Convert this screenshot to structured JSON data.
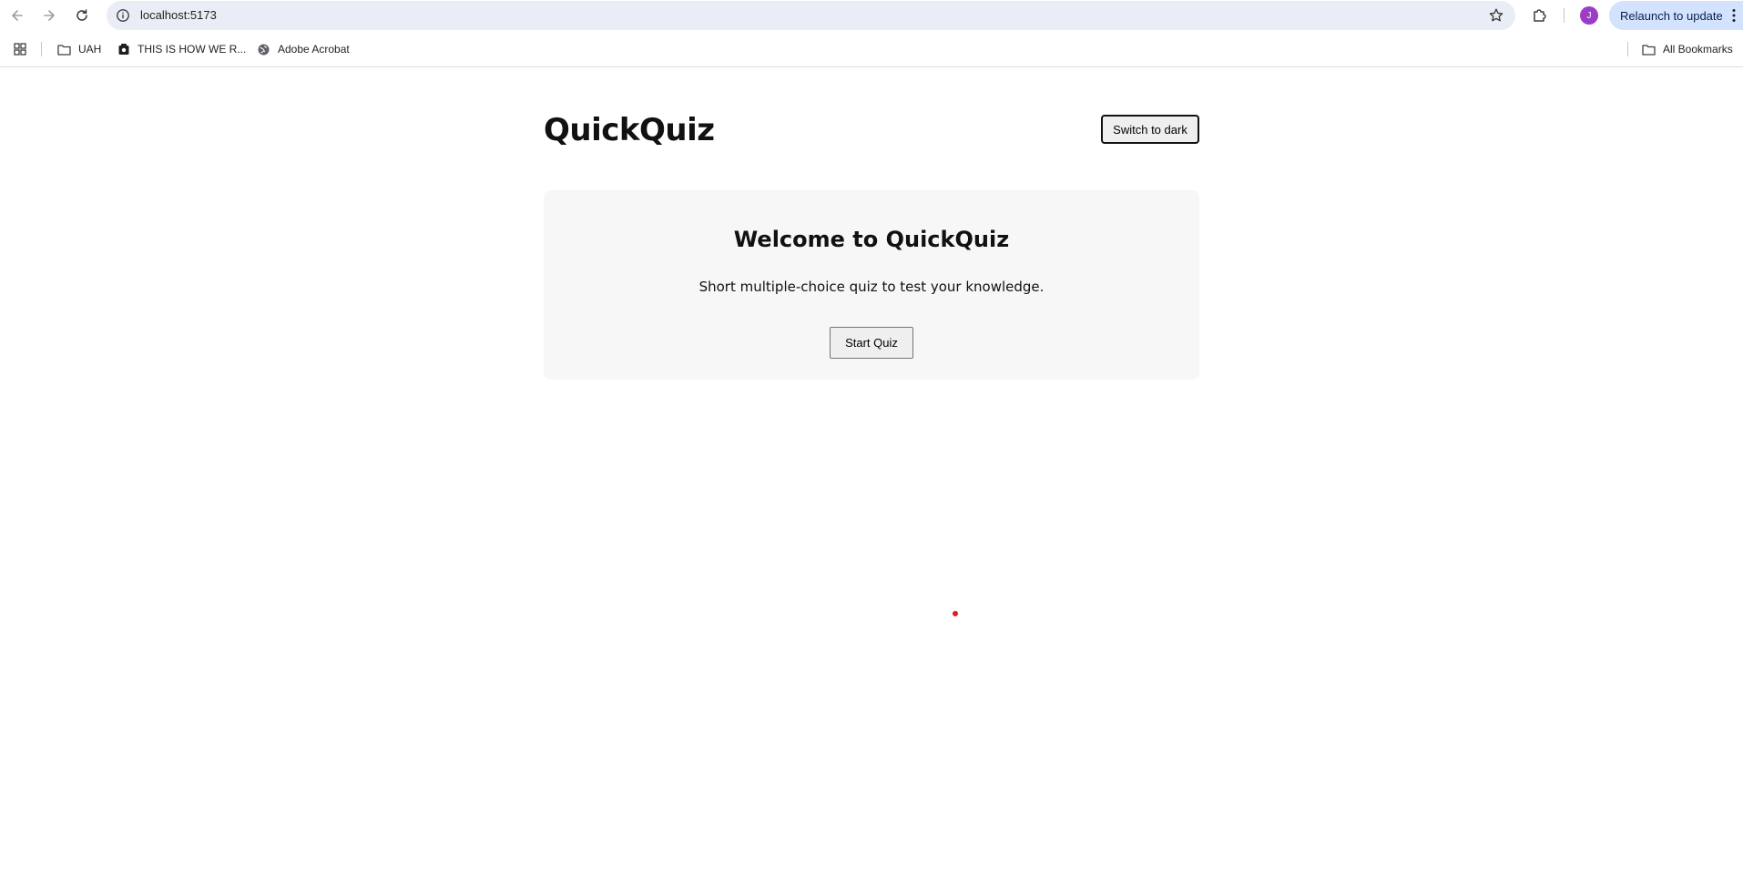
{
  "browser": {
    "url": "localhost:5173",
    "profile_initial": "J",
    "relaunch_label": "Relaunch to update",
    "icons": {
      "back": "arrow-left-icon",
      "forward": "arrow-right-icon",
      "reload": "reload-icon",
      "site_info": "info-icon",
      "bookmark_star": "star-icon",
      "extensions": "puzzle-icon",
      "menu": "kebab-icon"
    }
  },
  "bookmarks": {
    "items": [
      {
        "label": "UAH",
        "icon": "folder-icon"
      },
      {
        "label": "THIS IS HOW WE R...",
        "icon": "bookmark-favicon-icon"
      },
      {
        "label": "Adobe Acrobat",
        "icon": "globe-icon"
      }
    ],
    "all_bookmarks_label": "All Bookmarks"
  },
  "app": {
    "title": "QuickQuiz",
    "theme_toggle_label": "Switch to dark",
    "welcome": {
      "heading": "Welcome to QuickQuiz",
      "description": "Short multiple-choice quiz to test your knowledge.",
      "start_label": "Start Quiz"
    }
  },
  "colors": {
    "omnibox_bg": "#e9eef6",
    "relaunch_bg": "#d3e3fd",
    "avatar_bg": "#9c3dc6",
    "card_bg": "#f7f7f7",
    "cursor_dot": "#e01b24"
  }
}
